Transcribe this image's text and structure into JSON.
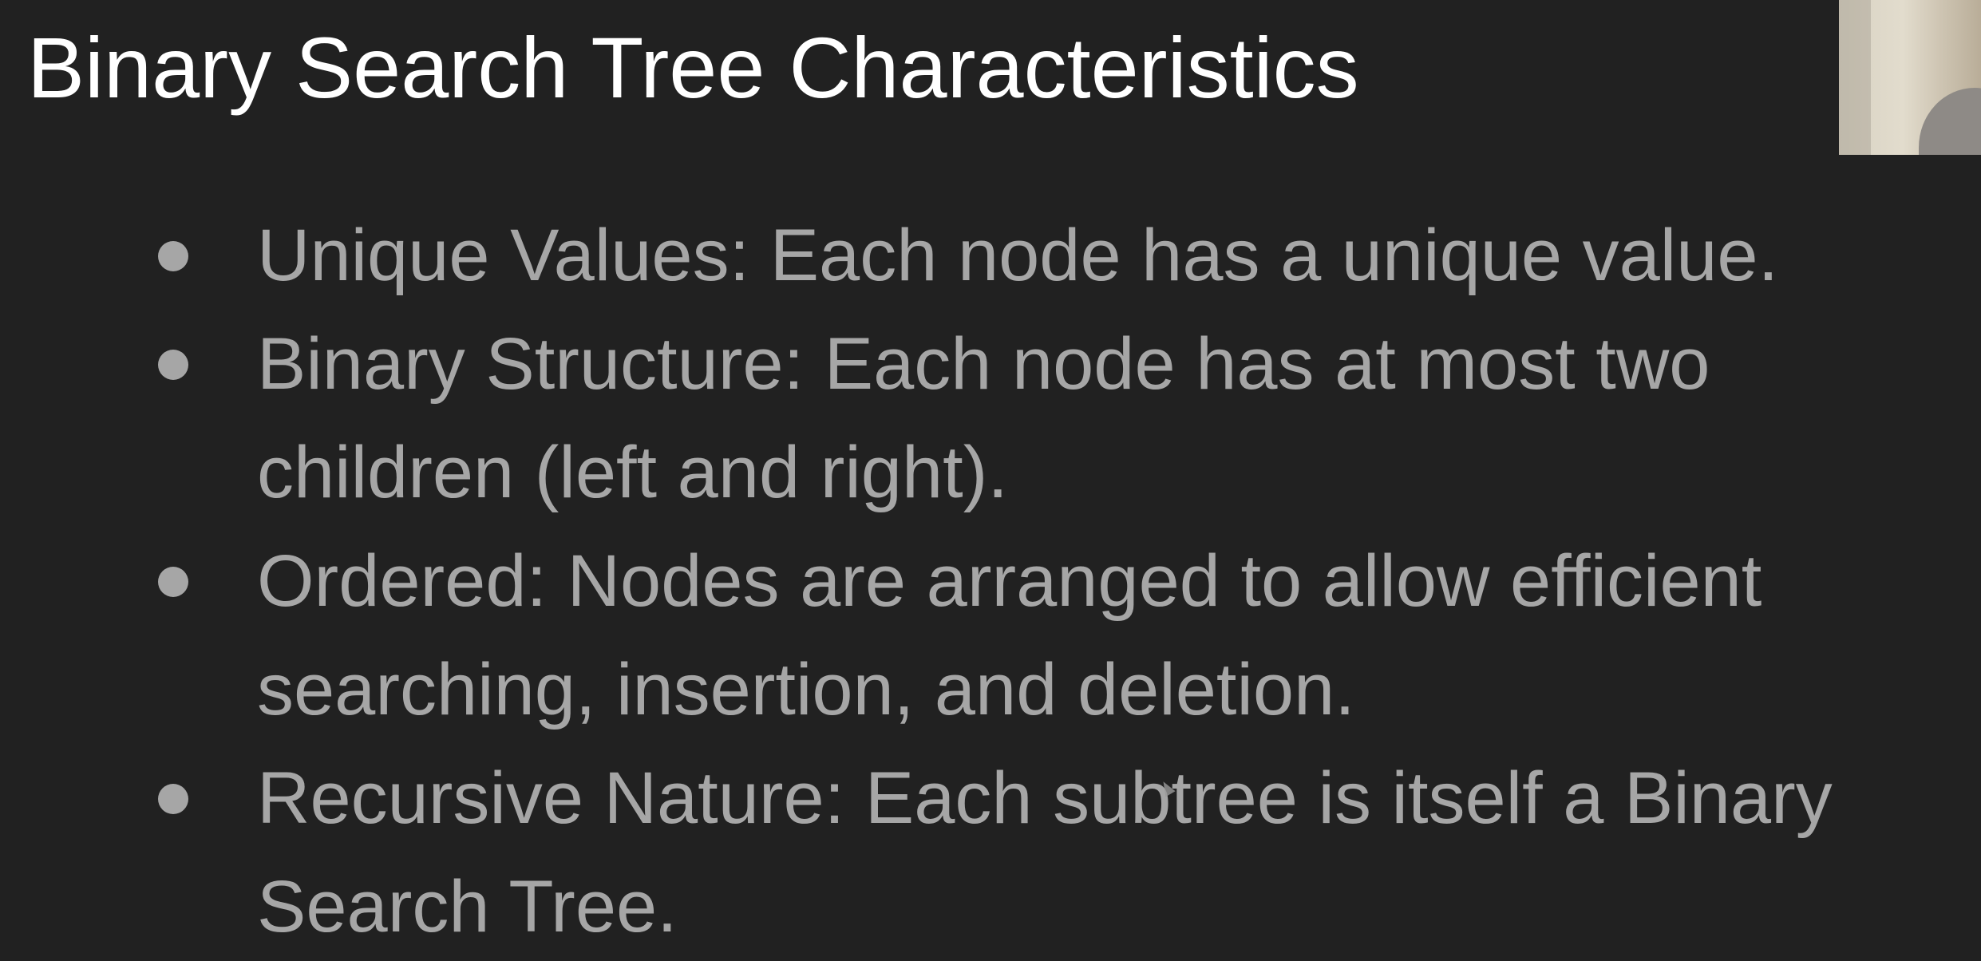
{
  "slide": {
    "title": "Binary Search Tree Characteristics",
    "bullets": [
      {
        "lines": [
          "Unique Values: Each node has a unique value."
        ]
      },
      {
        "lines": [
          "Binary Structure: Each node has at most two",
          "children (left and right)."
        ]
      },
      {
        "lines": [
          "Ordered: Nodes are arranged to allow efficient",
          "searching, insertion, and deletion."
        ]
      },
      {
        "lines": [
          "Recursive Nature: Each subtree is itself a Binary",
          "Search Tree."
        ]
      }
    ]
  },
  "colors": {
    "background": "#212121",
    "title": "#ffffff",
    "bullet_text": "#a6a6a6"
  },
  "overlay": {
    "webcam_icon": "presenter-webcam-thumbnail",
    "cursor_icon": "mouse-pointer-icon"
  }
}
